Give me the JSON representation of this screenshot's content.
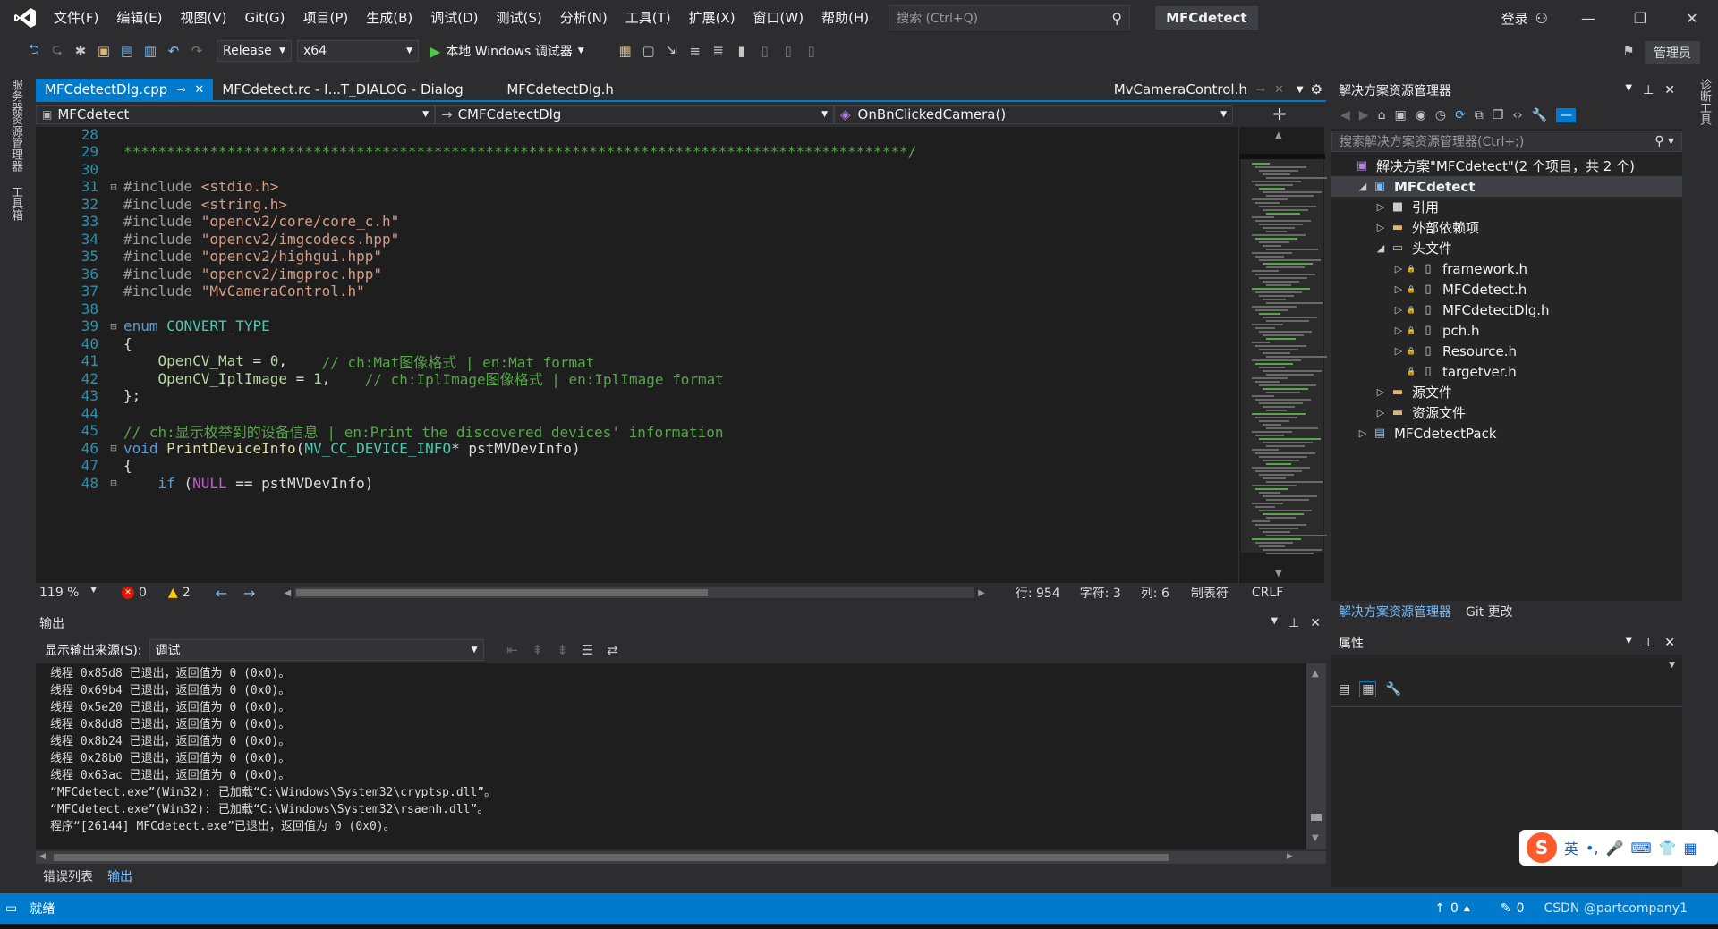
{
  "menu": [
    "文件(F)",
    "编辑(E)",
    "视图(V)",
    "Git(G)",
    "项目(P)",
    "生成(B)",
    "调试(D)",
    "测试(S)",
    "分析(N)",
    "工具(T)",
    "扩展(X)",
    "窗口(W)",
    "帮助(H)"
  ],
  "search": {
    "placeholder": "搜索 (Ctrl+Q)"
  },
  "app_title": "MFCdetect",
  "login_label": "登录",
  "admin_label": "管理员",
  "toolbar": {
    "config": "Release",
    "platform": "x64",
    "run_label": "本地 Windows 调试器"
  },
  "left_rail": {
    "server_explorer": "服务器资源管理器",
    "toolbox": "工具箱"
  },
  "right_rail": {
    "diagnostics": "诊断工具"
  },
  "editor_tabs": [
    {
      "label": "MFCdetectDlg.cpp",
      "active": true
    },
    {
      "label": "MFCdetect.rc - I...T_DIALOG - Dialog"
    },
    {
      "label": "MFCdetectDlg.h"
    },
    {
      "label": "MvCameraControl.h"
    }
  ],
  "navbar": {
    "project": "MFCdetect",
    "class": "CMFCdetectDlg",
    "member": "OnBnClickedCamera()"
  },
  "code": [
    {
      "ln": "28",
      "text": ""
    },
    {
      "ln": "29",
      "text": "*******************************************************************************************/"
    },
    {
      "ln": "30",
      "text": ""
    },
    {
      "ln": "31",
      "pp": "#include ",
      "str": "<stdio.h>"
    },
    {
      "ln": "32",
      "pp": "#include ",
      "str": "<string.h>"
    },
    {
      "ln": "33",
      "pp": "#include ",
      "str": "\"opencv2/core/core_c.h\""
    },
    {
      "ln": "34",
      "pp": "#include ",
      "str": "\"opencv2/imgcodecs.hpp\""
    },
    {
      "ln": "35",
      "pp": "#include ",
      "str": "\"opencv2/highgui.hpp\""
    },
    {
      "ln": "36",
      "pp": "#include ",
      "str": "\"opencv2/imgproc.hpp\""
    },
    {
      "ln": "37",
      "pp": "#include ",
      "str": "\"MvCameraControl.h\""
    },
    {
      "ln": "38",
      "text": ""
    },
    {
      "ln": "39",
      "kw": "enum ",
      "type": "CONVERT_TYPE"
    },
    {
      "ln": "40",
      "text": "{"
    },
    {
      "ln": "41",
      "enum": "    OpenCV_Mat",
      "text": " = ",
      "num": "0",
      "rest": ",    ",
      "comment": "// ch:Mat图像格式 | en:Mat format"
    },
    {
      "ln": "42",
      "enum": "    OpenCV_IplImage",
      "text": " = ",
      "num": "1",
      "rest": ",    ",
      "comment": "// ch:IplImage图像格式 | en:IplImage format"
    },
    {
      "ln": "43",
      "text": "};"
    },
    {
      "ln": "44",
      "text": ""
    },
    {
      "ln": "45",
      "comment": "// ch:显示枚举到的设备信息 | en:Print the discovered devices' information"
    },
    {
      "ln": "46",
      "kw": "void ",
      "fn": "PrintDeviceInfo",
      "text": "(",
      "type": "MV_CC_DEVICE_INFO",
      "rest": "* pstMVDevInfo)"
    },
    {
      "ln": "47",
      "text": "{"
    },
    {
      "ln": "48",
      "kw": "    if ",
      "text": "(",
      "macro": "NULL",
      "rest": " == pstMVDevInfo)"
    }
  ],
  "editor_status": {
    "zoom": "119 %",
    "errors": "0",
    "warnings": "2",
    "line": "行: 954",
    "char": "字符: 3",
    "col": "列: 6",
    "tabs": "制表符",
    "eol": "CRLF"
  },
  "output": {
    "title": "输出",
    "source_label": "显示输出来源(S):",
    "source_value": "调试",
    "lines": [
      "线程 0x85d8 已退出，返回值为 0 (0x0)。",
      "线程 0x69b4 已退出，返回值为 0 (0x0)。",
      "线程 0x5e20 已退出，返回值为 0 (0x0)。",
      "线程 0x8dd8 已退出，返回值为 0 (0x0)。",
      "线程 0x8b24 已退出，返回值为 0 (0x0)。",
      "线程 0x28b0 已退出，返回值为 0 (0x0)。",
      "线程 0x63ac 已退出，返回值为 0 (0x0)。",
      "“MFCdetect.exe”(Win32): 已加载“C:\\Windows\\System32\\cryptsp.dll”。",
      "“MFCdetect.exe”(Win32): 已加载“C:\\Windows\\System32\\rsaenh.dll”。",
      "程序“[26144] MFCdetect.exe”已退出，返回值为 0 (0x0)。"
    ]
  },
  "bottom_tabs": [
    "错误列表",
    "输出"
  ],
  "solution": {
    "title": "解决方案资源管理器",
    "search_placeholder": "搜索解决方案资源管理器(Ctrl+;)",
    "tree": [
      {
        "level": 0,
        "arrow": "",
        "label": "解决方案\"MFCdetect\"(2 个项目，共 2 个)",
        "icon": "solution-icon"
      },
      {
        "level": 1,
        "arrow": "◢",
        "label": "MFCdetect",
        "icon": "project-icon",
        "bold": true,
        "selected": true
      },
      {
        "level": 2,
        "arrow": "▷",
        "label": "引用",
        "icon": "references-icon"
      },
      {
        "level": 2,
        "arrow": "▷",
        "label": "外部依赖项",
        "icon": "folder-icon"
      },
      {
        "level": 2,
        "arrow": "◢",
        "label": "头文件",
        "icon": "folder-open-icon"
      },
      {
        "level": 3,
        "arrow": "▷",
        "label": "framework.h",
        "icon": "header-file-icon"
      },
      {
        "level": 3,
        "arrow": "▷",
        "label": "MFCdetect.h",
        "icon": "header-file-icon"
      },
      {
        "level": 3,
        "arrow": "▷",
        "label": "MFCdetectDlg.h",
        "icon": "header-file-icon"
      },
      {
        "level": 3,
        "arrow": "▷",
        "label": "pch.h",
        "icon": "header-file-icon"
      },
      {
        "level": 3,
        "arrow": "▷",
        "label": "Resource.h",
        "icon": "header-file-icon"
      },
      {
        "level": 3,
        "arrow": "",
        "label": "targetver.h",
        "icon": "header-file-icon"
      },
      {
        "level": 2,
        "arrow": "▷",
        "label": "源文件",
        "icon": "folder-icon"
      },
      {
        "level": 2,
        "arrow": "▷",
        "label": "资源文件",
        "icon": "folder-icon"
      },
      {
        "level": 1,
        "arrow": "▷",
        "label": "MFCdetectPack",
        "icon": "package-project-icon"
      }
    ],
    "bottom_tabs": [
      "解决方案资源管理器",
      "Git 更改"
    ]
  },
  "properties": {
    "title": "属性"
  },
  "ime": {
    "lang": "英"
  },
  "statusbar": {
    "ready": "就绪",
    "up_count": "0",
    "pencil_count": "0",
    "watermark": "CSDN @partcompany1"
  },
  "colors": {
    "accent": "#007acc",
    "editor_bg": "#1e1e1e",
    "panel_bg": "#252526",
    "chrome_bg": "#2d2d30"
  }
}
